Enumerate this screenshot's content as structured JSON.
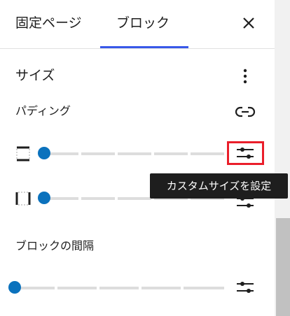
{
  "tabs": [
    {
      "label": "固定ページ",
      "active": false
    },
    {
      "label": "ブロック",
      "active": true
    }
  ],
  "accent_color": "#3858e9",
  "slider_color": "#0b72bd",
  "highlight_color": "#ea1e2a",
  "icons": {
    "close": "close-icon",
    "more": "more-vertical-icon",
    "link": "link-icon",
    "custom": "sliders-icon",
    "side": "box-side-icon"
  },
  "size_panel": {
    "title": "サイズ",
    "padding": {
      "label": "パディング",
      "sliders": [
        {
          "side": "top-bottom",
          "value": 0
        },
        {
          "side": "left-right",
          "value": 0
        }
      ]
    },
    "block_gap": {
      "label": "ブロックの間隔",
      "slider_value": 0
    }
  },
  "tooltip": {
    "text": "カスタムサイズを設定"
  }
}
